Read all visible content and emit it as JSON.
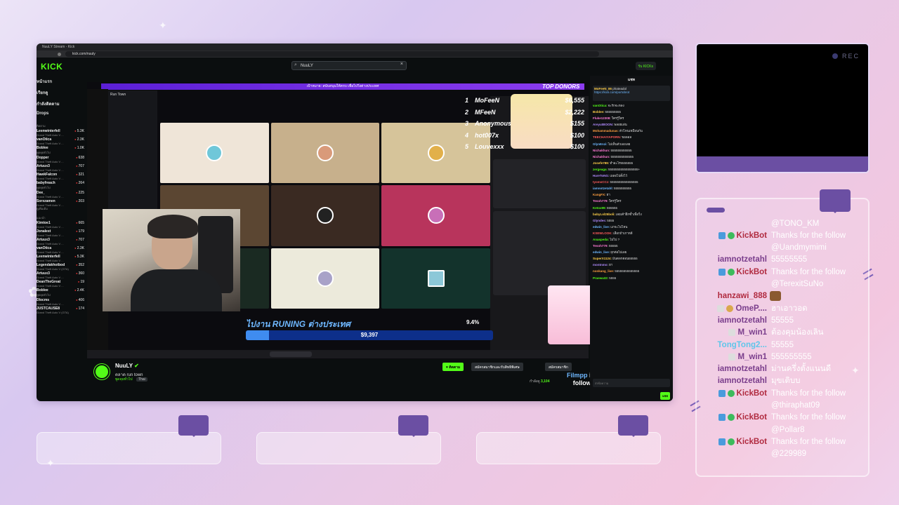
{
  "browser": {
    "tab_title": "NuuLY Stream - Kick",
    "url": "kick.com/nuuly",
    "logo": "KICK",
    "search_value": "NuuLY",
    "kicks_label": "รับ KICKs"
  },
  "left_nav": {
    "items": [
      "หน้าแรก",
      "เรียกดู",
      "กำลังติดตาม",
      "Drops"
    ],
    "section_following": "ติดตาม",
    "channels": [
      {
        "name": "Leenwinterfell",
        "viewers": "5.3K",
        "game": "Grand Theft Auto V ..."
      },
      {
        "name": "vanOtica",
        "viewers": "2.3K",
        "game": "Grand Theft Auto V ..."
      },
      {
        "name": "Boblee",
        "viewers": "1.0K",
        "game": "พูดคุยทั่วไป"
      },
      {
        "name": "Dopper",
        "viewers": "638",
        "game": "Grand Theft Auto V ..."
      },
      {
        "name": "Artuux3",
        "viewers": "707",
        "game": "Grand Theft Auto V ..."
      },
      {
        "name": "HawkFalcon",
        "viewers": "321",
        "game": "Grand Theft Auto V ..."
      },
      {
        "name": "babyfreach",
        "viewers": "264",
        "game": "พูดคุยทั่วไป"
      },
      {
        "name": "Dee_",
        "viewers": "225",
        "game": "Grand Theft Auto V ..."
      },
      {
        "name": "Sorxzamen",
        "viewers": "203",
        "game": "Grand Theft Auto V ..."
      }
    ],
    "more_label": "ดูเพิ่มเติม",
    "section_recommended": "แนะนำ",
    "recommended": [
      {
        "name": "Kimtoe1",
        "viewers": "665",
        "game": "Grand Theft Auto V ..."
      },
      {
        "name": "Jonalest",
        "viewers": "179",
        "game": "Grand Theft Auto V ..."
      },
      {
        "name": "Artuux3",
        "viewers": "707",
        "game": "Grand Theft Auto V ..."
      },
      {
        "name": "vanOtica",
        "viewers": "2.3K",
        "game": "Grand Theft Auto V ..."
      },
      {
        "name": "Leenwinterfell",
        "viewers": "5.3K",
        "game": "Grand Theft Auto V ..."
      },
      {
        "name": "Legendakhotbod",
        "viewers": "352",
        "game": "Grand Theft Auto V (GTA)"
      },
      {
        "name": "Artuux3",
        "viewers": "360",
        "game": "Grand Theft Auto V ..."
      },
      {
        "name": "DeanTheGreat",
        "viewers": "19",
        "game": "Grand Theft Auto V ..."
      },
      {
        "name": "Boblee",
        "viewers": "2.4K",
        "game": "พูดคุยทั่วไป"
      },
      {
        "name": "Dlocms",
        "viewers": "406",
        "game": "Grand Theft Auto V ..."
      },
      {
        "name": "JUSTCAUSE8",
        "viewers": "174",
        "game": "Grand Theft Auto V (GTA)"
      }
    ]
  },
  "stream": {
    "bar_text": "เป้าหมาย: สนับสนุนให้ครบ เพื่อไปวิ่งต่างประเทศ",
    "top_donors_title": "TOP DONORS",
    "donors": [
      {
        "rank": "1",
        "name": "MoFeeN",
        "amount": "$6,555"
      },
      {
        "rank": "2",
        "name": "MFeeN",
        "amount": "$2,222"
      },
      {
        "rank": "3",
        "name": "Anonymous",
        "amount": "$155"
      },
      {
        "rank": "4",
        "name": "hot007x",
        "amount": "$100"
      },
      {
        "rank": "5",
        "name": "Louvexxx",
        "amount": "$100"
      }
    ],
    "goal_title": "ไปงาน RUNING ต่างประเทศ",
    "goal_percent": "9.4%",
    "goal_amount": "$9,397",
    "goal_fraction": 0.094,
    "alert_name": "Filmpp",
    "alert_text": "is now following!",
    "run_town_label": "Run Town"
  },
  "stream_info": {
    "streamer": "NuuLY",
    "title": "ตลาด run town",
    "category": "พูดคุยทั่วไป",
    "tag": "Thai",
    "follow_label": "ติดตาม",
    "subscribe_label": "สมัครสมาชิกและรับสิทธิพิเศษ",
    "clip_label": "สมัครสมาชิก",
    "viewers_label": "กำลังดู",
    "viewers": "3,104"
  },
  "kick_chat": {
    "header": "แชท",
    "pinned_user": "MoFeeN_86",
    "pinned_text": "phateadol",
    "pinned_link": "https://kick.com/portobrot",
    "messages": [
      {
        "user": "vanOtica:",
        "text": "จะรักจะหลง",
        "color": "#53fc18"
      },
      {
        "user": "Boblee:",
        "text": "555555555",
        "color": "#ffcf4a"
      },
      {
        "user": "Fluke12308:",
        "text": "ใครรู้ใคร",
        "color": "#ff7bd5"
      },
      {
        "user": "AreyutBOON:",
        "text": "พลอยเล่น",
        "color": "#b28cff"
      },
      {
        "user": "Mohammadunas:",
        "text": "ตัวไหนเหมือนกัน",
        "color": "#ff9f40"
      },
      {
        "user": "TEECHAIYAPORN:",
        "text": "ขอลอล",
        "color": "#ff5c5c"
      },
      {
        "user": "GlynEnzi:",
        "text": "ไม่เห็นตัวเองเลย",
        "color": "#6fb8ff"
      },
      {
        "user": "Nichakhun:",
        "text": "555555555555",
        "color": "#ff7bd5"
      },
      {
        "user": "Nichakhun:",
        "text": "5555555555555",
        "color": "#ff7bd5"
      },
      {
        "user": "Josefe789:",
        "text": "ทำอะไร5555555",
        "color": "#ffcf4a"
      },
      {
        "user": "zergeaga:",
        "text": "55555555555555555+",
        "color": "#53fc18"
      },
      {
        "user": "HareToNG:",
        "text": "เผลอไปตั้งไว้",
        "color": "#b28cff"
      },
      {
        "user": "tyomsCCz:",
        "text": "5555555555555555",
        "color": "#ff5c5c"
      },
      {
        "user": "iamnotzetahl:",
        "text": "5555555555",
        "color": "#6fb8ff"
      },
      {
        "user": "KangFX:",
        "text": "ฮา",
        "color": "#ff9f40"
      },
      {
        "user": "Tesoh779:",
        "text": "ใครรู้ใคร",
        "color": "#ff7bd5"
      },
      {
        "user": "Ketox99:",
        "text": "555555",
        "color": "#53fc18"
      },
      {
        "user": "babyLol25boli:",
        "text": "เลยเค้าฝึกซ้ำเพื่อวิ่ง",
        "color": "#ffcf4a"
      },
      {
        "user": "Glyndes:",
        "text": "5555",
        "color": "#b28cff"
      },
      {
        "user": "edwin_live:",
        "text": "แกจะไปไหน",
        "color": "#6fb8ff"
      },
      {
        "user": "KSEWLOOK:",
        "text": "เลือกถ้าเกาหลี",
        "color": "#ff5c5c"
      },
      {
        "user": "Anaspeda:",
        "text": "ไม่ไป ?",
        "color": "#53fc18"
      },
      {
        "user": "Tesoh779:",
        "text": "55555",
        "color": "#ff7bd5"
      },
      {
        "user": "edwin_live:",
        "text": "ยุกต่อไปเลย",
        "color": "#6fb8ff"
      },
      {
        "user": "SuperX1124:",
        "text": "มันตลกตอน55555",
        "color": "#ffcf4a"
      },
      {
        "user": "montnmo:",
        "text": "ฮา",
        "color": "#b28cff"
      },
      {
        "user": "nonkang_live:",
        "text": "55555555555555",
        "color": "#ff9f40"
      },
      {
        "user": "Praewa32:",
        "text": "5555",
        "color": "#53fc18"
      }
    ],
    "input_placeholder": "ส่งข้อความ",
    "send_label": "แชท",
    "user_count": "0"
  },
  "overlay_cam": {
    "rec_label": "REC"
  },
  "overlay_chat": {
    "messages": [
      {
        "user": "",
        "text": "@TONO_KM",
        "cont": true
      },
      {
        "user": "KickBot",
        "text": "Thanks for the follow",
        "badges": [
          "bot",
          "ok"
        ],
        "kind": "kb"
      },
      {
        "user": "",
        "text": "@Uandmymimi",
        "cont": true
      },
      {
        "user": "iamnotzetahl",
        "text": "55555555",
        "kind": "mw"
      },
      {
        "user": "KickBot",
        "text": "Thanks for the follow",
        "badges": [
          "bot",
          "ok"
        ],
        "kind": "kb"
      },
      {
        "user": "",
        "text": "@TerexitSuNo",
        "cont": true
      },
      {
        "user": "hanzawi_888",
        "text": "",
        "kind": "kb",
        "emote": true
      },
      {
        "user": "OmeP....",
        "text": "ฮาเอาวอด",
        "badges": [
          "ld",
          "mod"
        ],
        "kind": "mw"
      },
      {
        "user": "iamnotzetahl",
        "text": "55555",
        "kind": "mw"
      },
      {
        "user": "M_win1",
        "text": "ต้องคุมน้องเลิน",
        "badges": [
          "ld"
        ],
        "kind": "mw"
      },
      {
        "user": "TongTong2...",
        "text": "55555",
        "kind": "cy"
      },
      {
        "user": "M_win1",
        "text": "555555555",
        "badges": [
          "ld"
        ],
        "kind": "mw"
      },
      {
        "user": "iamnotzetahl",
        "text": "ม่านครึ่งตั้งแนนดี",
        "kind": "mw"
      },
      {
        "user": "iamnotzetahl",
        "text": "มุขเติบบ",
        "kind": "mw"
      },
      {
        "user": "KickBot",
        "text": "Thanks for the follow",
        "badges": [
          "bot",
          "ok"
        ],
        "kind": "kb"
      },
      {
        "user": "",
        "text": "@thiraphat09",
        "cont": true
      },
      {
        "user": "KickBot",
        "text": "Thanks for the follow",
        "badges": [
          "bot",
          "ok"
        ],
        "kind": "kb"
      },
      {
        "user": "",
        "text": "@Pollar8",
        "cont": true
      },
      {
        "user": "KickBot",
        "text": "Thanks for the follow",
        "badges": [
          "bot",
          "ok"
        ],
        "kind": "kb"
      },
      {
        "user": "",
        "text": "@229989",
        "cont": true
      }
    ]
  },
  "colors": {
    "kick_green": "#53fc18",
    "panel_purple": "#6b4fa3",
    "kickbot_red": "#b02a3f",
    "username_purple": "#7a3e8c"
  }
}
